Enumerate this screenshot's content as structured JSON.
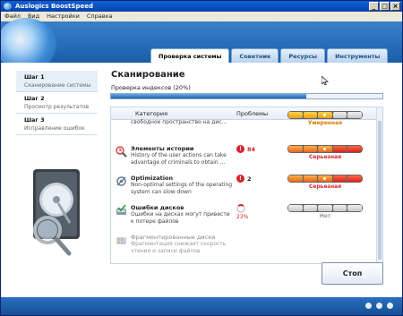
{
  "window": {
    "title": "Auslogics BoostSpeed",
    "controls": [
      "_",
      "□",
      "×"
    ]
  },
  "menu": [
    "Файл",
    "Вид",
    "Настройки",
    "Справка"
  ],
  "tabs": [
    {
      "label": "Проверка системы",
      "active": true
    },
    {
      "label": "Советник",
      "active": false
    },
    {
      "label": "Ресурсы",
      "active": false
    },
    {
      "label": "Инструменты",
      "active": false
    }
  ],
  "steps": [
    {
      "title": "Шаг 1",
      "subtitle": "Сканирование системы",
      "active": true
    },
    {
      "title": "Шаг 2",
      "subtitle": "Просмотр результатов",
      "active": false
    },
    {
      "title": "Шаг 3",
      "subtitle": "Исправление ошибок",
      "active": false
    }
  ],
  "main": {
    "title": "Сканирование",
    "subtitle": "Проверка индексов (20%)",
    "progress": 0.72
  },
  "table": {
    "columns": {
      "category": "Категория",
      "problems": "Проблемы",
      "speed_loss": "Потеря скорости"
    },
    "rows": [
      {
        "name": "",
        "desc": "свободное пространство на дис...",
        "problems": "",
        "severity": "Умеренная",
        "severity_color": "#d47a00",
        "level": 3
      },
      {
        "name": "Элементы истории",
        "desc": "History of the user actions can take advantage of criminals to obtain ...",
        "problems": "84",
        "severity": "Серьезная",
        "severity_color": "#d8232a",
        "level": 4
      },
      {
        "name": "Optimization",
        "desc": "Non-optimal settings of the operating system can slow down",
        "problems": "2",
        "severity": "Серьезная",
        "severity_color": "#d8232a",
        "level": 4
      },
      {
        "name": "Ошибки дисков",
        "desc": "Ошибки на дисках могут привести к потере файлов",
        "problems": "23%",
        "severity": "Нет",
        "severity_color": "#9a9a9a",
        "level": 0
      },
      {
        "name": "Фрагментированные диски",
        "desc": "Фрагментация снижает скорость чтения и записи файлов",
        "problems": "",
        "severity": "",
        "severity_color": "#9a9a9a",
        "level": 0
      }
    ]
  },
  "stop_button": "Стоп",
  "colors": {
    "header": "#1a5ea8",
    "accent": "#d8232a",
    "meter_orange": "#e8641b"
  },
  "icons": [
    "globe-icon",
    "history-icon",
    "optimization-icon",
    "disk-check-icon",
    "defrag-icon",
    "hdd-magnifier-icon"
  ]
}
